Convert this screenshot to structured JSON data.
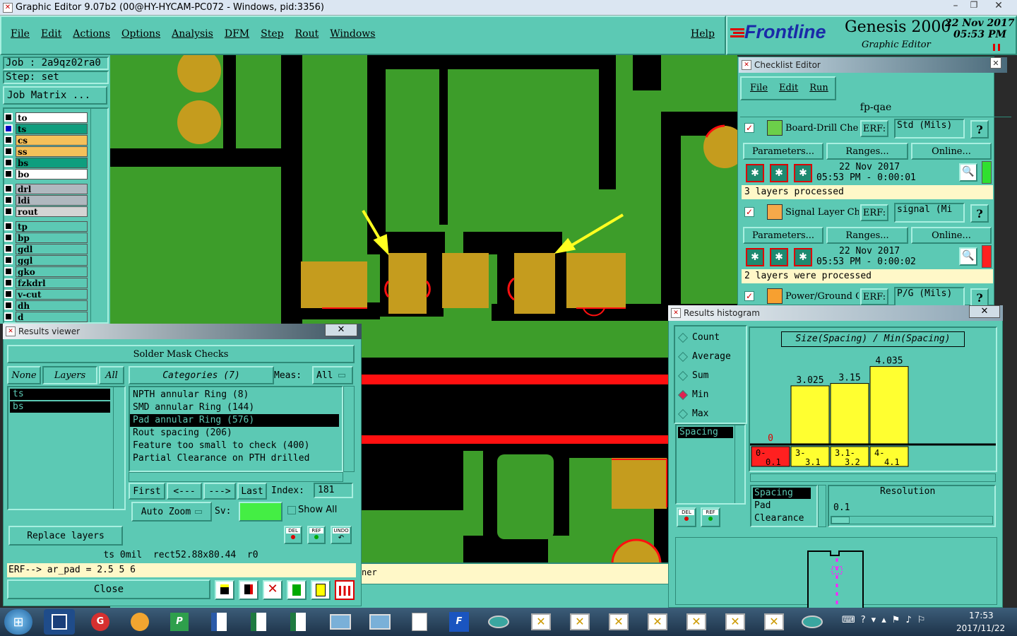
{
  "window": {
    "title": "Graphic Editor 9.07b2 (00@HY-HYCAM-PC072 - Windows, pid:3356)"
  },
  "menu": {
    "items": [
      "File",
      "Edit",
      "Actions",
      "Options",
      "Analysis",
      "DFM",
      "Step",
      "Rout",
      "Windows"
    ],
    "help": "Help"
  },
  "brand": {
    "logo": "Frontline",
    "product": "Genesis 2000",
    "subtitle": "Graphic Editor",
    "date": "22 Nov 2017",
    "time": "05:53 PM"
  },
  "job": {
    "job_label": "Job : 2a9qz02ra0",
    "step_label": "Step: set",
    "matrix_button": "Job Matrix ..."
  },
  "layers": {
    "group1": [
      {
        "name": "to",
        "color": "#ffffff"
      },
      {
        "name": "ts",
        "color": "#0f9e7e"
      },
      {
        "name": "cs",
        "color": "#f5c15a"
      },
      {
        "name": "ss",
        "color": "#f5c15a"
      },
      {
        "name": "bs",
        "color": "#0f9e7e"
      },
      {
        "name": "bo",
        "color": "#ffffff"
      }
    ],
    "group2": [
      {
        "name": "drl",
        "color": "#b0b8bf"
      },
      {
        "name": "ldi",
        "color": "#b0b8bf"
      },
      {
        "name": "rout",
        "color": "#d4d4d4"
      }
    ],
    "group3": [
      {
        "name": "tp"
      },
      {
        "name": "bp"
      },
      {
        "name": "gdl"
      },
      {
        "name": "ggl"
      },
      {
        "name": "gko"
      },
      {
        "name": "fzkdrl"
      },
      {
        "name": "v-cut"
      },
      {
        "name": "dh"
      },
      {
        "name": "d"
      }
    ]
  },
  "results_viewer": {
    "title": "Results viewer",
    "header": "Solder Mask Checks",
    "tab_none": "None",
    "tab_layers": "Layers",
    "tab_all": "All",
    "categories_label": "Categories (7)",
    "meas_label": "Meas:",
    "meas_value": "All",
    "layer_items": [
      "ts",
      "bs"
    ],
    "categories": [
      "NPTH annular Ring (8)",
      "SMD annular Ring (144)",
      "Pad annular Ring (576)",
      "Rout spacing (206)",
      "Feature too small to check (400)",
      "Partial Clearance on PTH drilled"
    ],
    "nav_first": "First",
    "nav_prev": "<---",
    "nav_next": "--->",
    "nav_last": "Last",
    "index_label": "Index:",
    "index_value": "181",
    "auto_zoom": "Auto Zoom",
    "sv_label": "Sv:",
    "show_all": "Show All",
    "replace_layers": "Replace layers",
    "icon_del": "DEL",
    "icon_ref": "REF",
    "icon_undo": "UNDO",
    "status": "ts 0mil  rect52.88x80.44  r0",
    "erf": "ERF--> ar_pad = 2.5 5 6",
    "close": "Close"
  },
  "checklist": {
    "title": "Checklist Editor",
    "menu": [
      "File",
      "Edit",
      "Run"
    ],
    "name": "fp-qae",
    "checks": [
      {
        "name": "Board-Drill Che",
        "erf_label": "ERF:",
        "erf_value": "Std (Mils)",
        "params": "Parameters...",
        "ranges": "Ranges...",
        "online": "Online...",
        "date": "22 Nov 2017",
        "time": "05:53 PM - 0:00:01",
        "status": "3 layers processed",
        "q": "?"
      },
      {
        "name": "Signal Layer Ch",
        "erf_label": "ERF:",
        "erf_value": "signal (Mi",
        "params": "Parameters...",
        "ranges": "Ranges...",
        "online": "Online...",
        "date": "22 Nov 2017",
        "time": "05:53 PM - 0:00:02",
        "status": "2 layers were processed",
        "q": "?"
      },
      {
        "name": "Power/Ground C",
        "erf_label": "ERF:",
        "erf_value": "P/G (Mils)",
        "q": "?"
      }
    ]
  },
  "histogram": {
    "title": "Results histogram",
    "modes": [
      "Count",
      "Average",
      "Sum",
      "Min",
      "Max"
    ],
    "selected_mode": "Min",
    "chart_title": "Size(Spacing) / Min(Spacing)",
    "list_item": "Spacing",
    "bins": [
      "0-0.1",
      "3-3.1",
      "3.1-3.2",
      "4-4.1"
    ],
    "sub_list": [
      "Spacing",
      "Pad",
      "Clearance"
    ],
    "resolution_label": "Resolution",
    "resolution_value": "0.1",
    "icon_del": "DEL",
    "icon_ref": "REF"
  },
  "chart_data": {
    "type": "bar",
    "title": "Size(Spacing) / Min(Spacing)",
    "categories": [
      "0-0.1",
      "3-3.1",
      "3.1-3.2",
      "4-4.1"
    ],
    "values": [
      0,
      3.025,
      3.15,
      4.035
    ],
    "value_labels": [
      "0",
      "3.025",
      "3.15",
      "4.035"
    ],
    "ylim": [
      0,
      4.5
    ],
    "colors": [
      "#ff2020",
      "#ffff30",
      "#ffff30",
      "#ffff30"
    ]
  },
  "canvas_status": {
    "text": "ner"
  },
  "taskbar": {
    "clock_time": "17:53",
    "clock_date": "2017/11/22"
  },
  "colors": {
    "teal": "#5cc9b4",
    "board_green": "#3d9d2a",
    "copper": "#c59c1e",
    "trace_black": "#000000",
    "highlight_red": "#ff1010",
    "arrow_yellow": "#ffff20"
  }
}
